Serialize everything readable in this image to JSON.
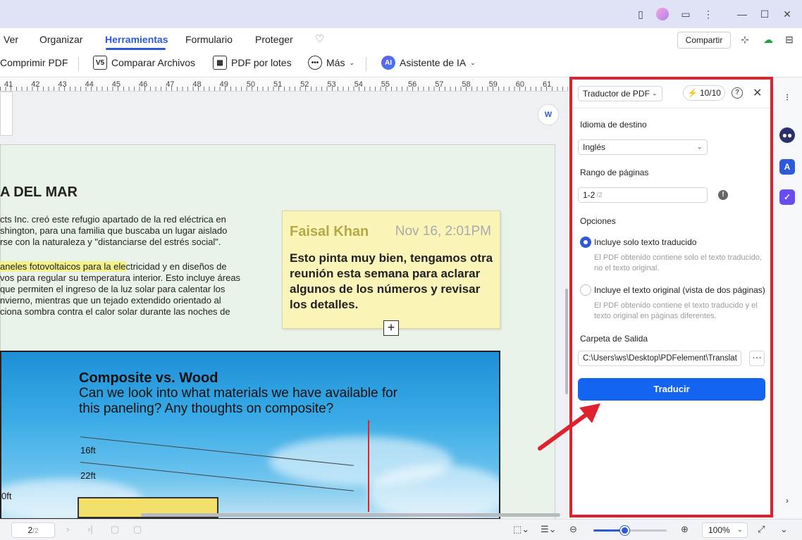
{
  "menu": {
    "items": [
      "Ver",
      "Organizar",
      "Herramientas",
      "Formulario",
      "Proteger"
    ],
    "share": "Compartir"
  },
  "toolbar": {
    "compress": "Comprimir PDF",
    "compare": "Comparar Archivos",
    "batch": "PDF por lotes",
    "more": "Más",
    "ai": "Asistente de IA"
  },
  "ruler": [
    "41",
    "42",
    "43",
    "44",
    "45",
    "46",
    "47",
    "48",
    "49",
    "50",
    "51",
    "52",
    "53",
    "54",
    "55",
    "56",
    "57",
    "58",
    "59",
    "60",
    "61"
  ],
  "document": {
    "title": "A DEL MAR",
    "para1": [
      "cts Inc. creó este refugio apartado de la red eléctrica en",
      "shington, para una familia que buscaba un lugar aislado",
      "rse con la naturaleza y \"distanciarse del estrés social\"."
    ],
    "para2_highlight": "aneles fotovoltaicos para la ele",
    "para2_rest": "ctricidad y en diseños de",
    "para2": [
      "vos para regular su temperatura interior. Esto incluye áreas",
      "que permiten el ingreso de la luz solar para calentar los",
      "nvierno, mientras que un tejado extendido orientado al",
      "ciona sombra contra el calor solar durante las noches de"
    ]
  },
  "sticky": {
    "author": "Faisal Khan",
    "date": "Nov 16, 2:01PM",
    "body": "Esto pinta muy bien, tengamos otra reunión esta semana para aclarar algunos de los números y revisar los detalles."
  },
  "photo": {
    "title": "Composite vs. Wood",
    "subtitle": "Can we look into what materials we have available for this paneling? Any thoughts on composite?",
    "labels": [
      "16ft",
      "22ft",
      "0ft"
    ]
  },
  "panel": {
    "tool": "Traductor de PDF",
    "credits": "10/10",
    "target_label": "Idioma de destino",
    "target_value": "Inglés",
    "range_label": "Rango de páginas",
    "range_value": "1-2",
    "range_total": "/2",
    "options_label": "Opciones",
    "opt1_label": "Incluye solo texto traducido",
    "opt1_desc": "El PDF obtenido contiene solo el texto traducido, no el texto original.",
    "opt2_label": "Incluye el texto original (vista de dos páginas)",
    "opt2_desc": "El PDF obtenido contiene el texto traducido y el texto original en páginas diferentes.",
    "folder_label": "Carpeta de Salida",
    "folder_value": "C:\\Users\\ws\\Desktop\\PDFelement\\Translat",
    "translate_button": "Traducir"
  },
  "status": {
    "page": "2",
    "page_total": "/2",
    "zoom": "100%",
    "zoom_level": 0.42
  },
  "colors": {
    "accent": "#2e5ad8",
    "primary_button": "#1364f0",
    "highlight_frame": "#e0222e"
  }
}
